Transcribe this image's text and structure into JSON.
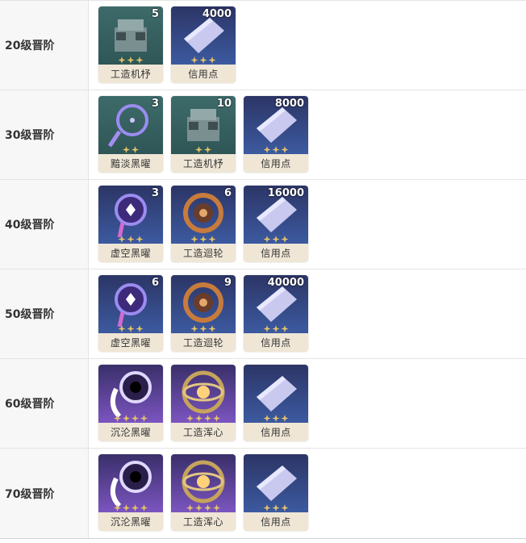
{
  "rows": [
    {
      "label": "20级晋阶",
      "items": [
        {
          "name": "工造机杼",
          "qty": "5",
          "icon": "gear-machine-icon",
          "bg": "green"
        },
        {
          "name": "信用点",
          "qty": "4000",
          "icon": "credit-card-icon",
          "bg": "blue"
        }
      ]
    },
    {
      "label": "30级晋阶",
      "items": [
        {
          "name": "黯淡黑曜",
          "qty": "3",
          "icon": "dreamcatcher-icon",
          "bg": "green"
        },
        {
          "name": "工造机杼",
          "qty": "10",
          "icon": "gear-machine-icon",
          "bg": "green"
        },
        {
          "name": "信用点",
          "qty": "8000",
          "icon": "credit-card-icon",
          "bg": "blue"
        }
      ]
    },
    {
      "label": "40级晋阶",
      "items": [
        {
          "name": "虚空黑曜",
          "qty": "3",
          "icon": "dreamcatcher-icon",
          "bg": "blue"
        },
        {
          "name": "工造迴轮",
          "qty": "6",
          "icon": "cog-wheel-icon",
          "bg": "blue"
        },
        {
          "name": "信用点",
          "qty": "16000",
          "icon": "credit-card-icon",
          "bg": "blue"
        }
      ]
    },
    {
      "label": "50级晋阶",
      "items": [
        {
          "name": "虚空黑曜",
          "qty": "6",
          "icon": "dreamcatcher-icon",
          "bg": "blue"
        },
        {
          "name": "工造迴轮",
          "qty": "9",
          "icon": "cog-wheel-icon",
          "bg": "blue"
        },
        {
          "name": "信用点",
          "qty": "40000",
          "icon": "credit-card-icon",
          "bg": "blue"
        }
      ]
    },
    {
      "label": "60级晋阶",
      "items": [
        {
          "name": "沉沦黑曜",
          "qty": "",
          "icon": "dreamcatcher-icon",
          "bg": "purple"
        },
        {
          "name": "工造浑心",
          "qty": "",
          "icon": "armillary-icon",
          "bg": "purple"
        },
        {
          "name": "信用点",
          "qty": "",
          "icon": "credit-card-icon",
          "bg": "blue"
        }
      ]
    },
    {
      "label": "70级晋阶",
      "items": [
        {
          "name": "沉沦黑曜",
          "qty": "",
          "icon": "dreamcatcher-icon",
          "bg": "purple"
        },
        {
          "name": "工造浑心",
          "qty": "",
          "icon": "armillary-icon",
          "bg": "purple"
        },
        {
          "name": "信用点",
          "qty": "",
          "icon": "credit-card-icon",
          "bg": "blue"
        }
      ]
    }
  ],
  "colors": {
    "name_bg": "#efe6d6",
    "label_bg": "#f7f7f7",
    "star": "#e6c36a"
  }
}
